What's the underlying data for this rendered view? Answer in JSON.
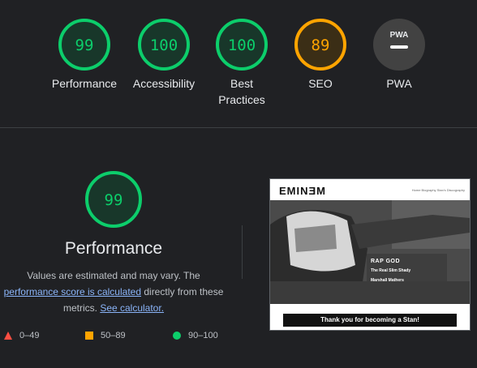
{
  "colors": {
    "pass": "#0cce6b",
    "average": "#ffa400",
    "fail": "#ff4e42",
    "neutral": "#9aa0a6"
  },
  "gauges": [
    {
      "score": 99,
      "label_line1": "Performance",
      "label_line2": "",
      "rating": "pass"
    },
    {
      "score": 100,
      "label_line1": "Accessibility",
      "label_line2": "",
      "rating": "pass"
    },
    {
      "score": 100,
      "label_line1": "Best",
      "label_line2": "Practices",
      "rating": "pass"
    },
    {
      "score": 89,
      "label_line1": "SEO",
      "label_line2": "",
      "rating": "average"
    }
  ],
  "pwa": {
    "badge_text": "PWA",
    "label": "PWA"
  },
  "performance": {
    "score": 99,
    "title": "Performance",
    "desc_line1": "Values are estimated and may vary. The",
    "link_score": "performance score is calculated",
    "desc_after_link": " directly from these",
    "desc_metrics": "metrics.",
    "link_calculator": "See calculator."
  },
  "legend": [
    {
      "range": "0–49",
      "shape": "triangle",
      "rating": "fail"
    },
    {
      "range": "50–89",
      "shape": "square",
      "rating": "average"
    },
    {
      "range": "90–100",
      "shape": "circle",
      "rating": "pass"
    }
  ],
  "screenshot": {
    "logo": "EMINƎM",
    "menu": "Home  Biography  Stan's  Discography",
    "card_title": "RAP GOD",
    "card_line2": "The Real Slim Shady",
    "card_line3": "Marshall Mathers",
    "banner": "Thank you for becoming a Stan!"
  }
}
